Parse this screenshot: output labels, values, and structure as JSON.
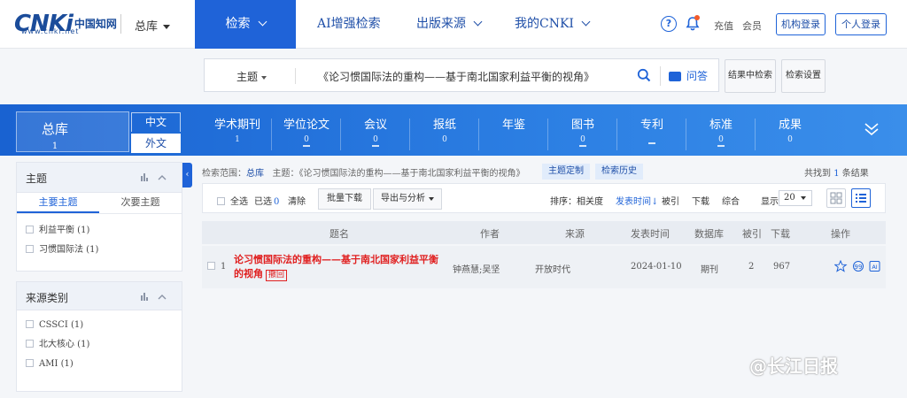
{
  "header": {
    "logo_mark": "CNKi",
    "logo_cn": "中国知网",
    "logo_url": "www.cnki.net",
    "library_select": "总库",
    "nav": [
      "检索",
      "AI增强检索",
      "出版来源",
      "我的CNKI"
    ],
    "help_icon": "?",
    "links": [
      "充值",
      "会员"
    ],
    "buttons": [
      "机构登录",
      "个人登录"
    ]
  },
  "search": {
    "field": "主题",
    "query": "《论习惯国际法的重构——基于南北国家利益平衡的视角》",
    "qa_label": "问答",
    "buttons": [
      "结果中检索",
      "检索设置"
    ]
  },
  "categories": {
    "total": {
      "label": "总库",
      "count": "1"
    },
    "lang": [
      "中文",
      "外文"
    ],
    "items": [
      {
        "label": "学术期刊",
        "count": "1"
      },
      {
        "label": "学位论文",
        "count": "0"
      },
      {
        "label": "会议",
        "count": "0"
      },
      {
        "label": "报纸",
        "count": "0"
      },
      {
        "label": "年鉴",
        "count": ""
      },
      {
        "label": "图书",
        "count": "0"
      },
      {
        "label": "专利",
        "count": ""
      },
      {
        "label": "标准",
        "count": "0"
      },
      {
        "label": "成果",
        "count": "0"
      }
    ]
  },
  "sidebar": {
    "topic": {
      "title": "主题",
      "tabs": [
        "主要主题",
        "次要主题"
      ],
      "items": [
        "利益平衡 (1)",
        "习惯国际法 (1)"
      ]
    },
    "source": {
      "title": "来源类别",
      "items": [
        "CSSCI (1)",
        "北大核心 (1)",
        "AMI (1)"
      ]
    }
  },
  "results": {
    "scope_label": "检索范围：",
    "scope_value": "总库",
    "topic_label": "主题：",
    "topic_value": "《论习惯国际法的重构——基于南北国家利益平衡的视角》",
    "chips": [
      "主题定制",
      "检索历史"
    ],
    "found_prefix": "共找到",
    "found_count": "1",
    "found_suffix": "条结果",
    "toolbar": {
      "select_all": "全选",
      "selected_label": "已选",
      "selected_count": "0",
      "clear": "清除",
      "batch_download": "批量下载",
      "export": "导出与分析",
      "sort_label": "排序：",
      "sort_options": [
        "相关度",
        "发表时间",
        "被引",
        "下载",
        "综合"
      ],
      "display_label": "显示",
      "page_size": "20"
    },
    "columns": [
      "题名",
      "作者",
      "来源",
      "发表时间",
      "数据库",
      "被引",
      "下载",
      "操作"
    ],
    "rows": [
      {
        "index": "1",
        "title": "论习惯国际法的重构——基于南北国家利益平衡的视角",
        "tag": "撤回",
        "author": "钟燕慧;吴坚",
        "source": "开放时代",
        "date": "2024-01-10",
        "db": "期刊",
        "cited": "2",
        "downloads": "967"
      }
    ]
  },
  "watermark": "@长江日报",
  "colors": {
    "accent": "#1f63d8",
    "retracted": "#e02020"
  }
}
